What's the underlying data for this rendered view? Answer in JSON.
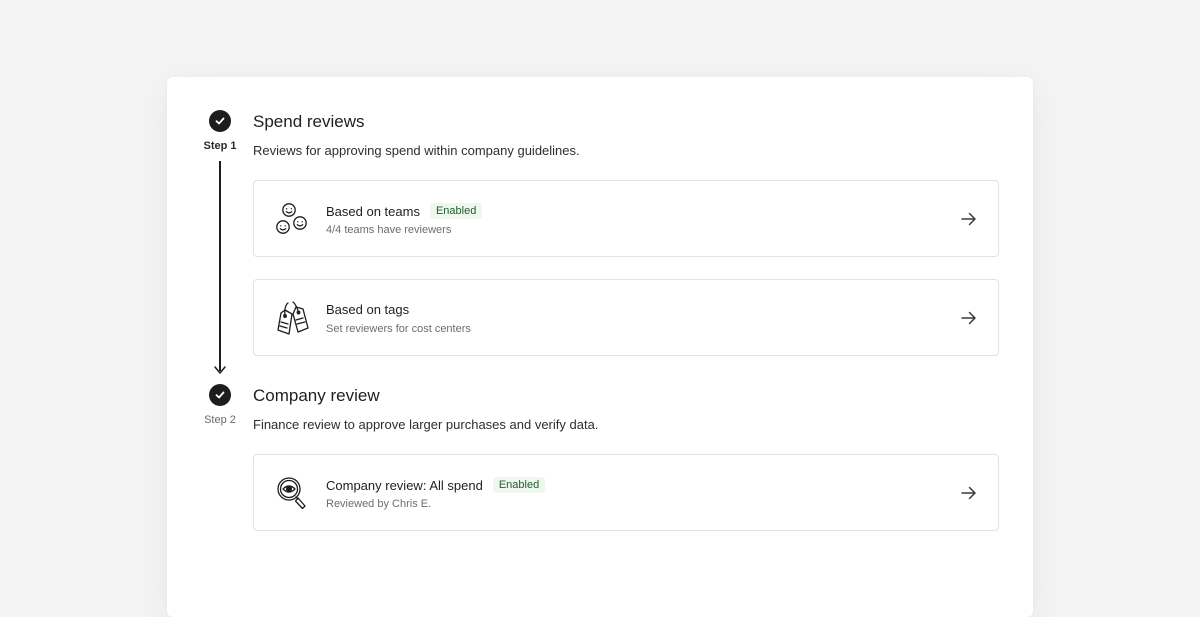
{
  "steps": [
    {
      "label": "Step 1",
      "title": "Spend reviews",
      "description": "Reviews for approving spend within company guidelines.",
      "items": [
        {
          "title": "Based on teams",
          "badge": "Enabled",
          "subtitle": "4/4 teams have reviewers",
          "icon": "team-faces-icon"
        },
        {
          "title": "Based on tags",
          "badge": "",
          "subtitle": "Set reviewers for cost centers",
          "icon": "price-tags-icon"
        }
      ]
    },
    {
      "label": "Step 2",
      "title": "Company review",
      "description": "Finance review to approve larger purchases and verify data.",
      "items": [
        {
          "title": "Company review: All spend",
          "badge": "Enabled",
          "subtitle": "Reviewed by Chris E.",
          "icon": "magnifier-eye-icon"
        }
      ]
    }
  ],
  "icons": {
    "step_complete": "check-icon",
    "row_action": "arrow-right-icon"
  },
  "colors": {
    "background": "#f4f4f4",
    "card": "#ffffff",
    "step_marker": "#1d1d1d",
    "badge_bg": "#eef6ee",
    "badge_text": "#21602f"
  }
}
